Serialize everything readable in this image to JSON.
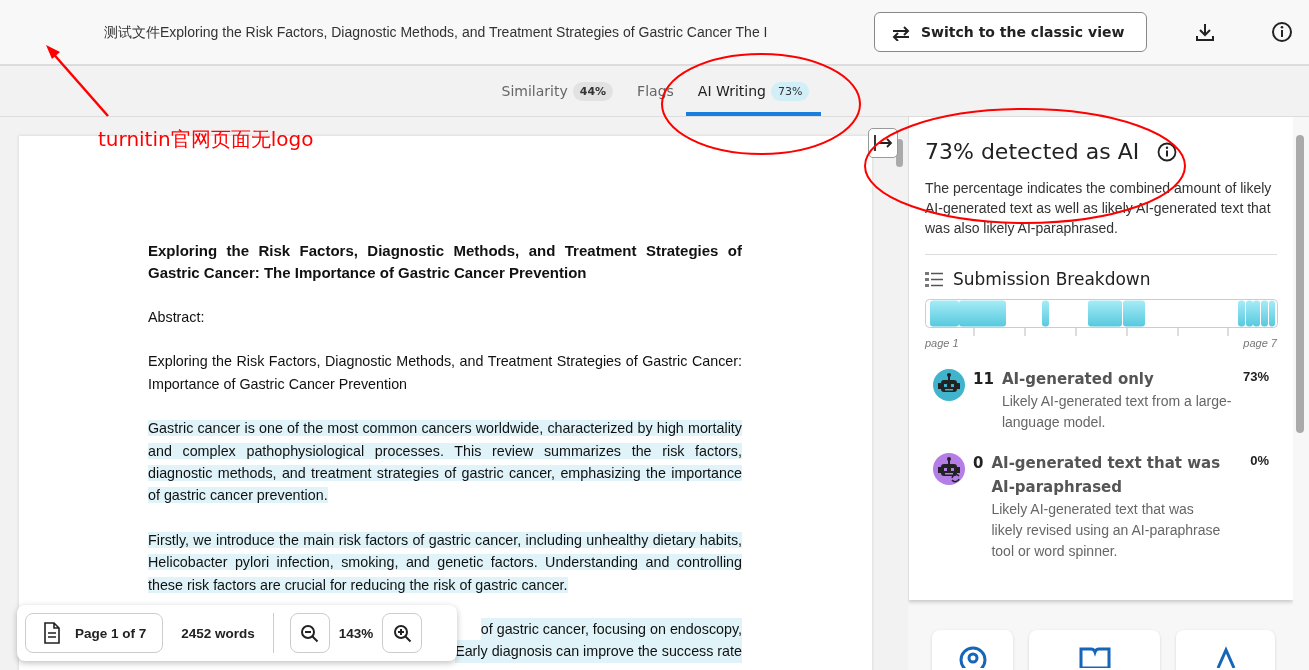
{
  "header": {
    "title": "测试文件Exploring the Risk Factors, Diagnostic Methods, and Treatment Strategies of Gastric Cancer The I",
    "switch_button": "Switch to the classic view"
  },
  "tabs": [
    {
      "label": "Similarity",
      "badge": "44%",
      "selected": false
    },
    {
      "label": "Flags",
      "selected": false
    },
    {
      "label": "AI Writing",
      "badge": "73%",
      "selected": true
    }
  ],
  "document": {
    "title": "Exploring the Risk Factors, Diagnostic Methods, and Treatment Strategies of Gastric Cancer: The Importance of Gastric Cancer Prevention",
    "paragraphs": [
      {
        "kind": "text",
        "text": "Abstract:",
        "highlighted": false
      },
      {
        "kind": "text",
        "text": "Exploring the Risk Factors, Diagnostic Methods, and Treatment Strategies of Gastric Cancer: Importance of Gastric Cancer Prevention",
        "highlighted": false
      },
      {
        "kind": "text",
        "text": "Gastric cancer is one of the most common cancers worldwide, characterized by high mortality and complex pathophysiological processes. This review summarizes the risk factors, diagnostic methods, and treatment strategies of gastric cancer, emphasizing the importance of gastric cancer prevention.",
        "highlighted": true
      },
      {
        "kind": "text",
        "text": "Firstly, we introduce the main risk factors of gastric cancer, including unhealthy dietary habits, Helicobacter pylori infection, smoking, and genetic factors. Understanding and controlling these risk factors are crucial for reducing the risk of gastric cancer.",
        "highlighted": true
      },
      {
        "kind": "partial",
        "lines": [
          "of gastric cancer, focusing on endoscopy,",
          "Early diagnosis can improve the success rate"
        ],
        "highlighted": true
      }
    ]
  },
  "toolbar": {
    "page": "Page 1 of 7",
    "words": "2452 words",
    "zoom": "143%"
  },
  "panel": {
    "heading": "73% detected as AI",
    "description": "The percentage indicates the combined amount of likely AI-generated text as well as likely AI-generated text that was also likely AI-paraphrased.",
    "breakdown_title": "Submission Breakdown",
    "start_label": "page 1",
    "end_label": "page 7",
    "categories": [
      {
        "count": "11",
        "title": "AI-generated only",
        "percent": "73%",
        "description": "Likely AI-generated text from a large-language model.",
        "color": "#3fb4cc"
      },
      {
        "count": "0",
        "title": "AI-generated text that was AI-paraphrased",
        "percent": "0%",
        "description": "Likely AI-generated text that was likely revised using an AI-paraphrase tool or word spinner.",
        "color": "#b47ee6"
      }
    ]
  },
  "annotation": {
    "note": "turnitin官网页面无logo"
  }
}
